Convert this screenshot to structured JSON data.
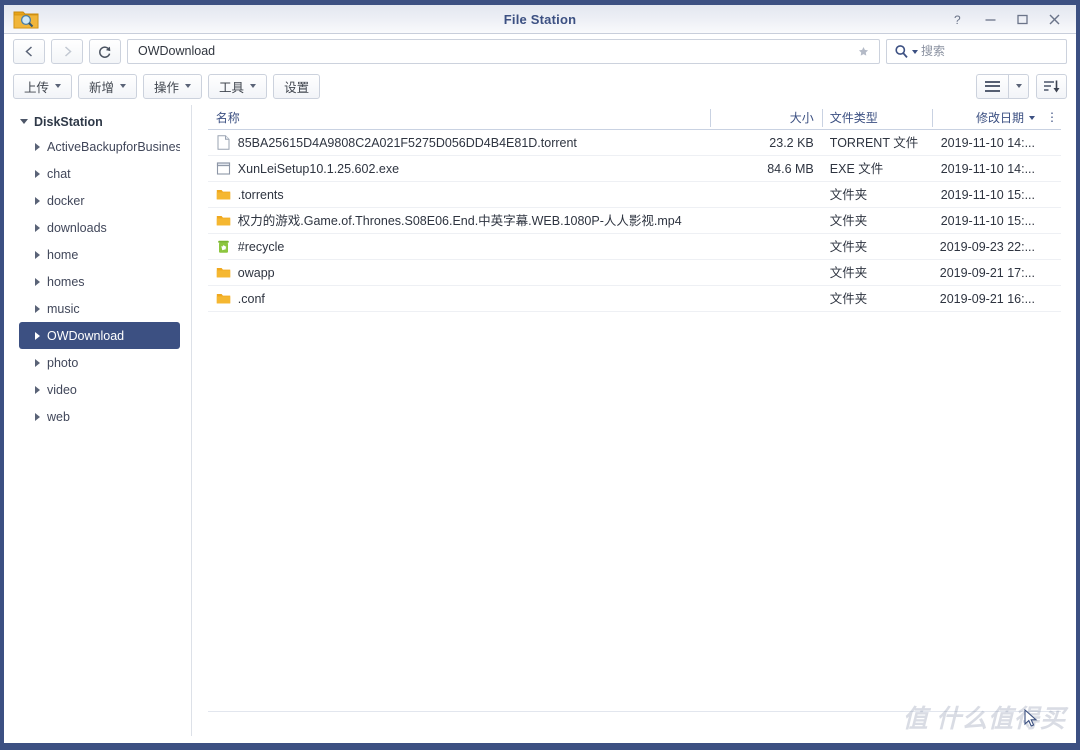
{
  "window": {
    "title": "File Station",
    "app_icon": "folder-search-icon",
    "controls": [
      {
        "name": "help-button",
        "glyph": "?"
      },
      {
        "name": "minimize-button",
        "glyph": "–"
      },
      {
        "name": "maximize-button",
        "glyph": "□"
      },
      {
        "name": "close-button",
        "glyph": "✕"
      }
    ],
    "accent_color": "#3c5082"
  },
  "addressbar": {
    "back_icon": "chevron-left-icon",
    "forward_icon": "chevron-right-icon",
    "refresh_icon": "refresh-icon",
    "path": "OWDownload",
    "favorite_icon": "star-icon"
  },
  "search": {
    "icon": "search-icon",
    "placeholder": "搜索"
  },
  "toolbar": {
    "buttons": [
      {
        "label": "上传",
        "has_caret": true,
        "name": "upload-button"
      },
      {
        "label": "新增",
        "has_caret": true,
        "name": "create-button"
      },
      {
        "label": "操作",
        "has_caret": true,
        "name": "action-button"
      },
      {
        "label": "工具",
        "has_caret": true,
        "name": "tools-button"
      },
      {
        "label": "设置",
        "has_caret": false,
        "name": "settings-button"
      }
    ],
    "view_mode_icon": "list-view-icon",
    "view_mode_caret_icon": "chevron-down-icon",
    "sort_icon": "sort-descending-icon"
  },
  "sidebar": {
    "root": {
      "label": "DiskStation",
      "expanded": true
    },
    "items": [
      {
        "label": "ActiveBackupforBusiness",
        "selected": false
      },
      {
        "label": "chat",
        "selected": false
      },
      {
        "label": "docker",
        "selected": false
      },
      {
        "label": "downloads",
        "selected": false
      },
      {
        "label": "home",
        "selected": false
      },
      {
        "label": "homes",
        "selected": false
      },
      {
        "label": "music",
        "selected": false
      },
      {
        "label": "OWDownload",
        "selected": true
      },
      {
        "label": "photo",
        "selected": false
      },
      {
        "label": "video",
        "selected": false
      },
      {
        "label": "web",
        "selected": false
      }
    ]
  },
  "filelist": {
    "columns": {
      "name": "名称",
      "size": "大小",
      "type": "文件类型",
      "date": "修改日期"
    },
    "sorted_by": "修改日期",
    "sort_direction": "desc",
    "column_menu_icon": "column-options-icon",
    "rows": [
      {
        "icon": "document-file-icon",
        "name": "85BA25615D4A9808C2A021F5275D056DD4B4E81D.torrent",
        "size": "23.2 KB",
        "type": "TORRENT 文件",
        "date": "2019-11-10 14:..."
      },
      {
        "icon": "application-exe-icon",
        "name": "XunLeiSetup10.1.25.602.exe",
        "size": "84.6 MB",
        "type": "EXE 文件",
        "date": "2019-11-10 14:..."
      },
      {
        "icon": "folder-icon",
        "name": ".torrents",
        "size": "",
        "type": "文件夹",
        "date": "2019-11-10 15:..."
      },
      {
        "icon": "folder-icon",
        "name": "权力的游戏.Game.of.Thrones.S08E06.End.中英字幕.WEB.1080P-人人影视.mp4",
        "size": "",
        "type": "文件夹",
        "date": "2019-11-10 15:..."
      },
      {
        "icon": "recycle-bin-icon",
        "name": "#recycle",
        "size": "",
        "type": "文件夹",
        "date": "2019-09-23 22:..."
      },
      {
        "icon": "folder-icon",
        "name": "owapp",
        "size": "",
        "type": "文件夹",
        "date": "2019-09-21 17:..."
      },
      {
        "icon": "folder-icon",
        "name": ".conf",
        "size": "",
        "type": "文件夹",
        "date": "2019-09-21 16:..."
      }
    ]
  },
  "watermark": {
    "text": "值 什么值得买"
  }
}
